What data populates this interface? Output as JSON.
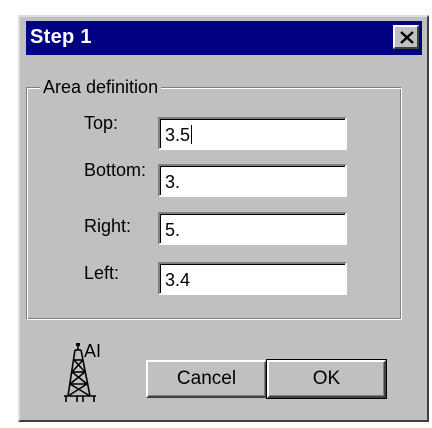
{
  "window": {
    "title": "Step 1",
    "close_icon": "close-icon"
  },
  "group": {
    "legend": "Area definition"
  },
  "fields": {
    "top": {
      "label": "Top:",
      "value": "3.5"
    },
    "bottom": {
      "label": "Bottom:",
      "value": "3."
    },
    "right": {
      "label": "Right:",
      "value": "5."
    },
    "left": {
      "label": "Left:",
      "value": "3.4"
    }
  },
  "buttons": {
    "cancel": "Cancel",
    "ok": "OK"
  },
  "logo": {
    "icon": "oil-derrick-icon",
    "text": "AI"
  }
}
